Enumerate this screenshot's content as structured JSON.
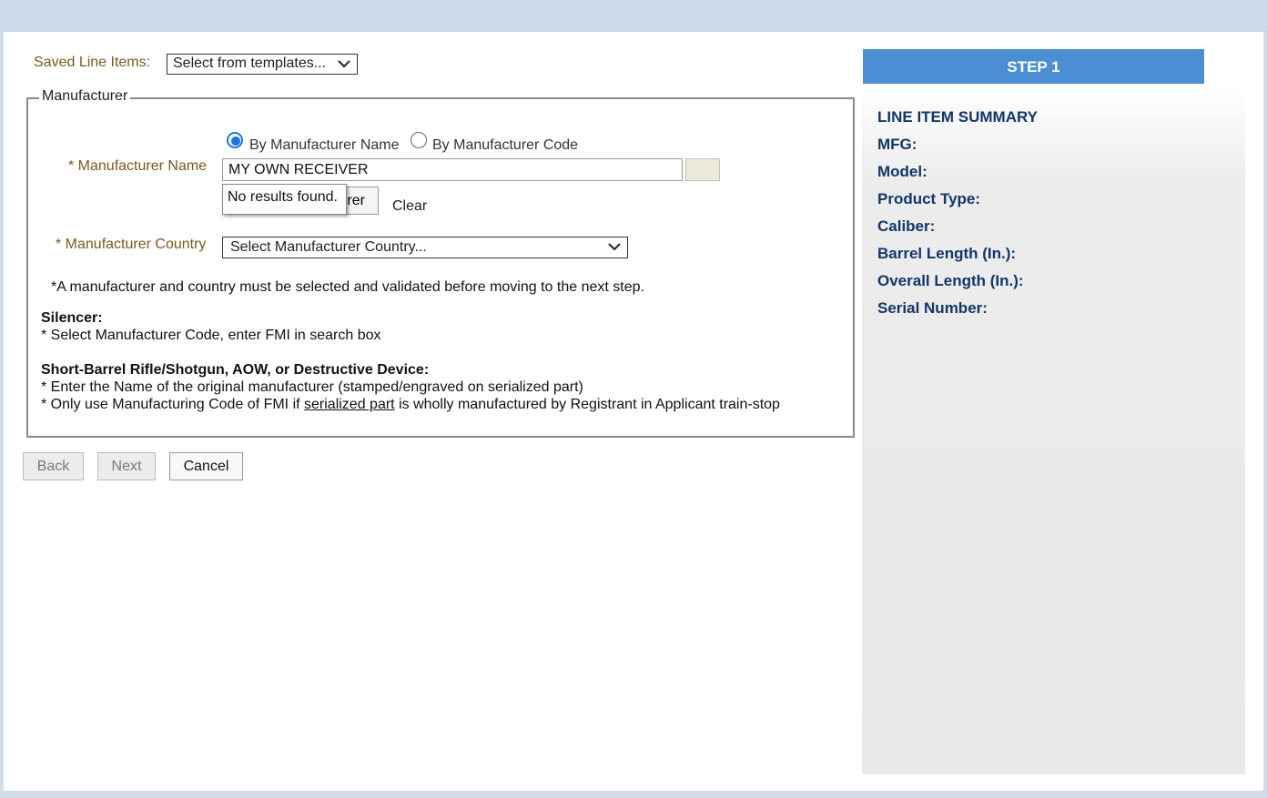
{
  "saved_line_items": {
    "label": "Saved Line Items:",
    "selected": "Select from templates..."
  },
  "manufacturer": {
    "legend": "Manufacturer",
    "radio_by_name": "By Manufacturer Name",
    "radio_by_code": "By Manufacturer Code",
    "name_label": "* Manufacturer Name",
    "name_value": "MY OWN RECEIVER",
    "tooltip": "No results found.",
    "hidden_button_fragment": "rer",
    "clear_label": "Clear",
    "country_label": "* Manufacturer Country",
    "country_selected": "Select Manufacturer Country...",
    "validation_note": "*A manufacturer and country must be selected and validated before moving to the next step.",
    "silencer_heading": "Silencer:",
    "silencer_note": "* Select Manufacturer Code, enter FMI in search box",
    "sbr_heading": "Short-Barrel Rifle/Shotgun, AOW, or Destructive Device:",
    "sbr_note_1": "* Enter the Name of the original manufacturer (stamped/engraved on serialized part)",
    "sbr_note_2_prefix": "* Only use Manufacturing Code of FMI if ",
    "sbr_note_2_link": "serialized part",
    "sbr_note_2_suffix": " is wholly manufactured by Registrant in Applicant train-stop"
  },
  "nav": {
    "back": "Back",
    "next": "Next",
    "cancel": "Cancel"
  },
  "summary": {
    "step": "STEP 1",
    "title": "LINE ITEM SUMMARY",
    "fields": [
      "MFG:",
      "Model:",
      "Product Type:",
      "Caliber:",
      "Barrel Length (In.):",
      "Overall Length (In.):",
      "Serial Number:"
    ]
  },
  "colors": {
    "accent_blue": "#4a8fd3",
    "summary_text": "#11376a",
    "label_tan": "#7a5a18",
    "radio_blue": "#1a73e8"
  }
}
